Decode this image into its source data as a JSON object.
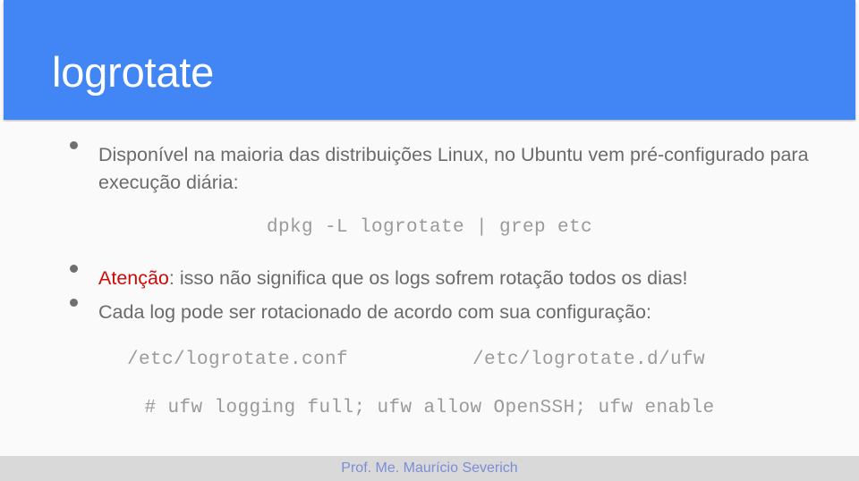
{
  "header": {
    "title": "logrotate",
    "background_color": "#4286f5",
    "title_color": "#ffffff"
  },
  "slide": {
    "background_color": "#fafafa",
    "body_text_color": "#6b6b6b",
    "code_text_color": "#9a9a9a",
    "accent_red": "#cc0a0a"
  },
  "bullets": [
    {
      "id": "availability",
      "text": "Disponível na maioria das distribuições Linux, no Ubuntu vem pré-configurado para execução diária:"
    },
    {
      "id": "attention",
      "lead": "Atenção",
      "text": ": isso não significa que os logs sofrem rotação todos os dias!"
    },
    {
      "id": "per-log-config",
      "text": "Cada log pode ser rotacionado de acordo com sua configuração:"
    }
  ],
  "code": {
    "command_dpkg": "dpkg -L logrotate | grep etc",
    "path_conf": "/etc/logrotate.conf",
    "path_d_ufw": "/etc/logrotate.d/ufw",
    "command_ufw": "# ufw logging full; ufw allow OpenSSH; ufw enable"
  },
  "footer": {
    "author": "Prof. Me. Maurício Severich",
    "band_color": "#d9d9d9",
    "text_color": "#7b8ed6"
  }
}
